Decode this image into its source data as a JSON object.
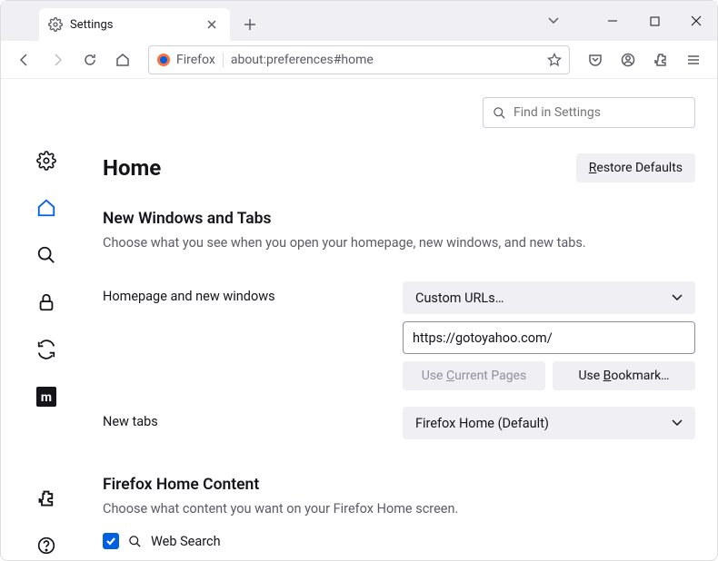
{
  "tab": {
    "title": "Settings"
  },
  "urlbar": {
    "identity": "Firefox",
    "address": "about:preferences#home"
  },
  "search": {
    "placeholder": "Find in Settings"
  },
  "page": {
    "title": "Home",
    "restore_defaults": "Restore Defaults"
  },
  "section_new_windows": {
    "heading": "New Windows and Tabs",
    "description": "Choose what you see when you open your homepage, new windows, and new tabs.",
    "homepage_label": "Homepage and new windows",
    "homepage_select": "Custom URLs…",
    "homepage_url": "https://gotoyahoo.com/",
    "use_current_prefix": "Use ",
    "use_current_underline": "C",
    "use_current_suffix": "urrent Pages",
    "use_bookmark_prefix": "Use ",
    "use_bookmark_underline": "B",
    "use_bookmark_suffix": "ookmark…",
    "newtabs_label": "New tabs",
    "newtabs_select": "Firefox Home (Default)"
  },
  "section_home_content": {
    "heading": "Firefox Home Content",
    "description": "Choose what content you want on your Firefox Home screen.",
    "web_search": "Web Search"
  }
}
